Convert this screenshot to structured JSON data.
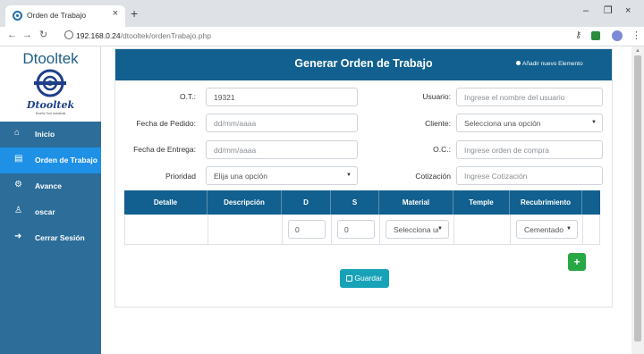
{
  "browser": {
    "tab_title": "Orden de Trabajo",
    "url_host": "192.168.0.24",
    "url_path": "/dtooltek/ordenTrabajo.php",
    "new_tab": "+",
    "tab_close": "×",
    "window_controls": [
      "–",
      "❐",
      "×"
    ]
  },
  "sidebar": {
    "brand_title": "Dtooltek",
    "brand_name": "Dtooltek",
    "brand_slogan": "Diseño Tool Industrial",
    "items": [
      {
        "label": "Inicio",
        "icon": "home-icon",
        "glyph": "⌂",
        "active": false
      },
      {
        "label": "Orden de Trabajo",
        "icon": "document-icon",
        "glyph": "▤",
        "active": true
      },
      {
        "label": "Avance",
        "icon": "gears-icon",
        "glyph": "⚙",
        "active": false
      },
      {
        "label": "oscar",
        "icon": "user-icon",
        "glyph": "♙",
        "active": false
      },
      {
        "label": "Cerrar Sesión",
        "icon": "sign-out-icon",
        "glyph": "➜",
        "active": false
      }
    ]
  },
  "form": {
    "title": "Generar Orden de Trabajo",
    "add_element": "Añadir nuevo Elemento",
    "ot_label": "O.T.:",
    "ot_value": "19321",
    "fecha_pedido_label": "Fecha de Pedido:",
    "fecha_pedido_placeholder": "dd/mm/aaaa",
    "fecha_entrega_label": "Fecha de Entrega:",
    "fecha_entrega_placeholder": "dd/mm/aaaa",
    "prioridad_label": "Prioridad",
    "prioridad_value": "Elija una opción",
    "usuario_label": "Usuario:",
    "usuario_placeholder": "Ingrese el nombre del usuario",
    "cliente_label": "Cliente:",
    "cliente_value": "Selecciona una opción",
    "oc_label": "O.C.:",
    "oc_placeholder": "Ingrese orden de compra",
    "cotizacion_label": "Cotización",
    "cotizacion_placeholder": "Ingrese Cotización"
  },
  "table": {
    "columns": [
      "Detalle",
      "Descripción",
      "D",
      "S",
      "Material",
      "Temple",
      "Recubrimiento"
    ],
    "row": {
      "d_value": "0",
      "s_value": "0",
      "material_value": "Selecciona una opción",
      "recubrimiento_value": "Cementado"
    }
  },
  "actions": {
    "add_row": "+",
    "save_label": "Guardar"
  },
  "colors": {
    "sidebar": "#2c6d99",
    "sidebar_active": "#1e90e6",
    "header": "#11608f",
    "save_button": "#17a2b8",
    "add_button": "#28a745"
  }
}
